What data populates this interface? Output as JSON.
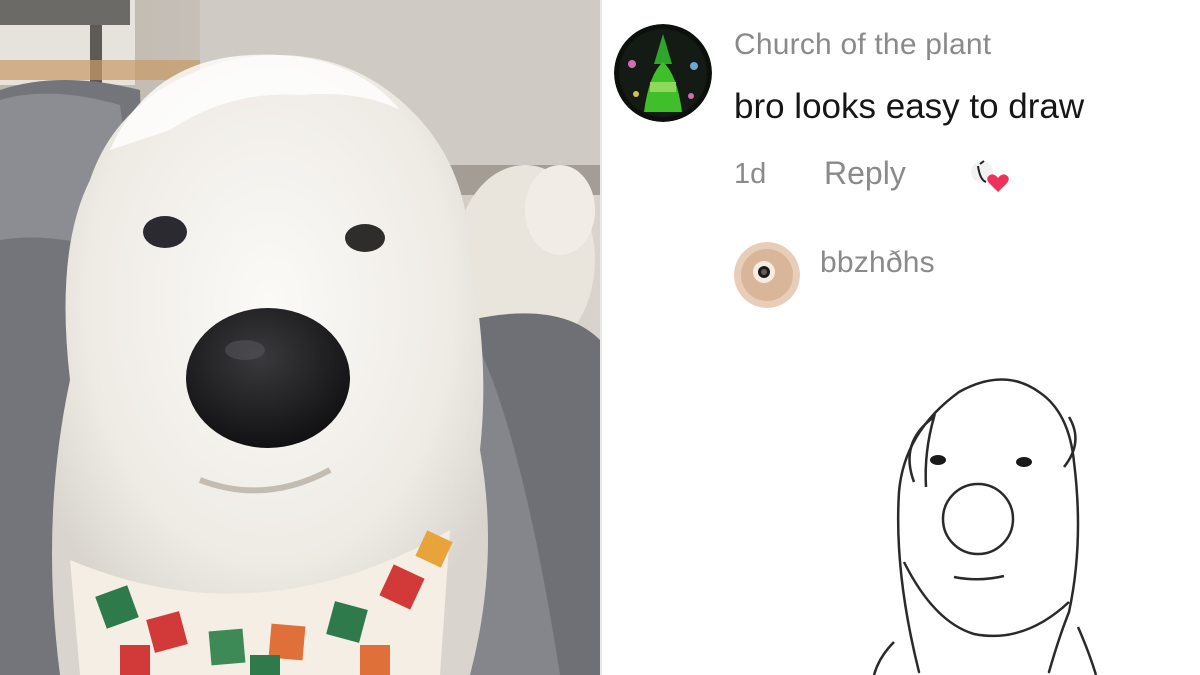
{
  "comment": {
    "username": "Church of the plant",
    "text": "bro looks easy to draw",
    "age": "1d",
    "reply_label": "Reply",
    "avatar_icon": "green-figure-avatar-icon",
    "liked_icon": "creator-liked-heart-icon"
  },
  "reply": {
    "username": "bbzhðhs",
    "avatar_icon": "face-avatar-icon",
    "attachment_icon": "dog-line-drawing"
  },
  "photo": {
    "subject": "white-dog-photo"
  },
  "colors": {
    "username_gray": "#8a8a8a",
    "text_dark": "#161616",
    "heart_pink": "#f0325a",
    "avatar_green": "#3fbf2a"
  }
}
